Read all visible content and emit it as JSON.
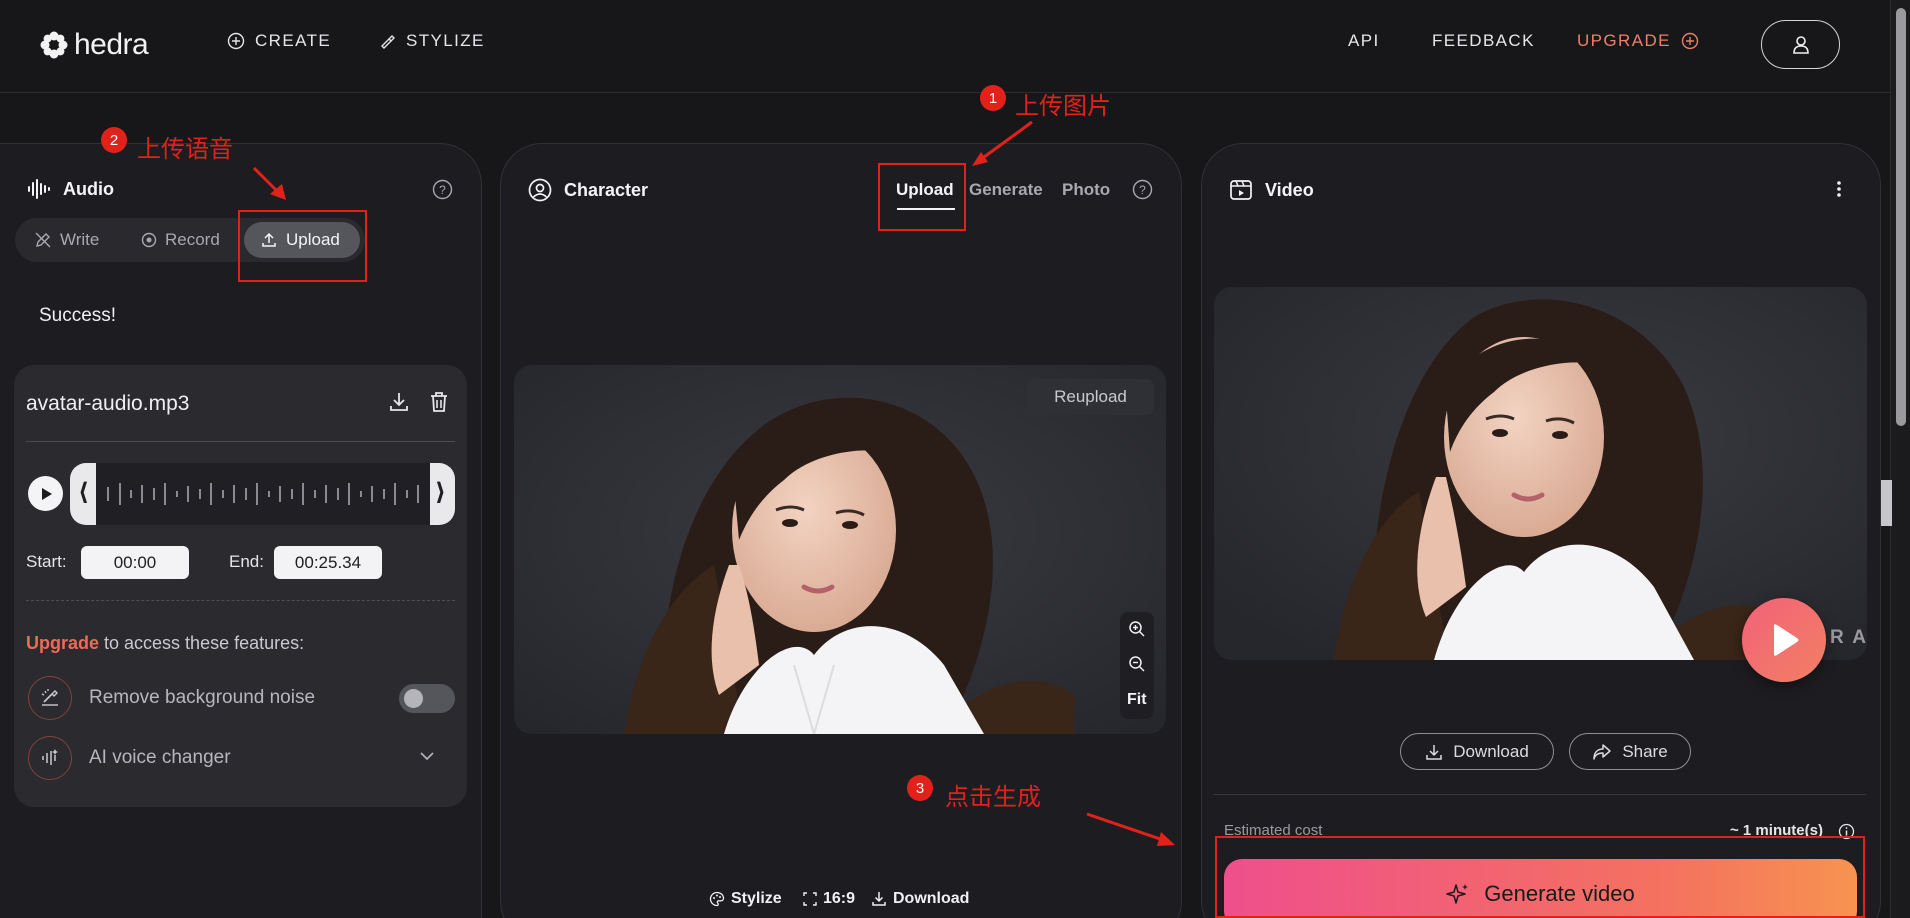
{
  "nav": {
    "logo_text": "hedra",
    "create": "CREATE",
    "stylize": "STYLIZE",
    "api": "API",
    "feedback": "FEEDBACK",
    "upgrade": "UPGRADE"
  },
  "audio": {
    "title": "Audio",
    "tabs": {
      "write": "Write",
      "record": "Record",
      "upload": "Upload"
    },
    "status": "Success!",
    "file_name": "avatar-audio.mp3",
    "start_label": "Start:",
    "start_value": "00:00",
    "end_label": "End:",
    "end_value": "00:25.34",
    "upgrade_word": "Upgrade",
    "upgrade_rest": " to access these features:",
    "features": {
      "noise": "Remove background noise",
      "voice": "AI voice changer"
    },
    "noise_toggle_on": false
  },
  "character": {
    "title": "Character",
    "tabs": {
      "upload": "Upload",
      "generate": "Generate",
      "photo": "Photo"
    },
    "reupload": "Reupload",
    "fit": "Fit",
    "footer": {
      "stylize": "Stylize",
      "ratio": "16:9",
      "download": "Download"
    }
  },
  "video": {
    "title": "Video",
    "watermark": "R A",
    "download": "Download",
    "share": "Share",
    "estimated_cost_label": "Estimated cost",
    "estimated_cost_value": "~ 1 minute(s)",
    "generate": "Generate video"
  },
  "annotations": {
    "step1_num": "1",
    "step1_text": "上传图片",
    "step2_num": "2",
    "step2_text": "上传语音",
    "step3_num": "3",
    "step3_text": "点击生成",
    "color": "#e0221b"
  },
  "colors": {
    "background": "#17171a",
    "panel": "#1d1d21",
    "upgrade_accent": "#ef7f69",
    "generate_gradient_start": "#ef4f8c",
    "generate_gradient_end": "#f79350"
  }
}
